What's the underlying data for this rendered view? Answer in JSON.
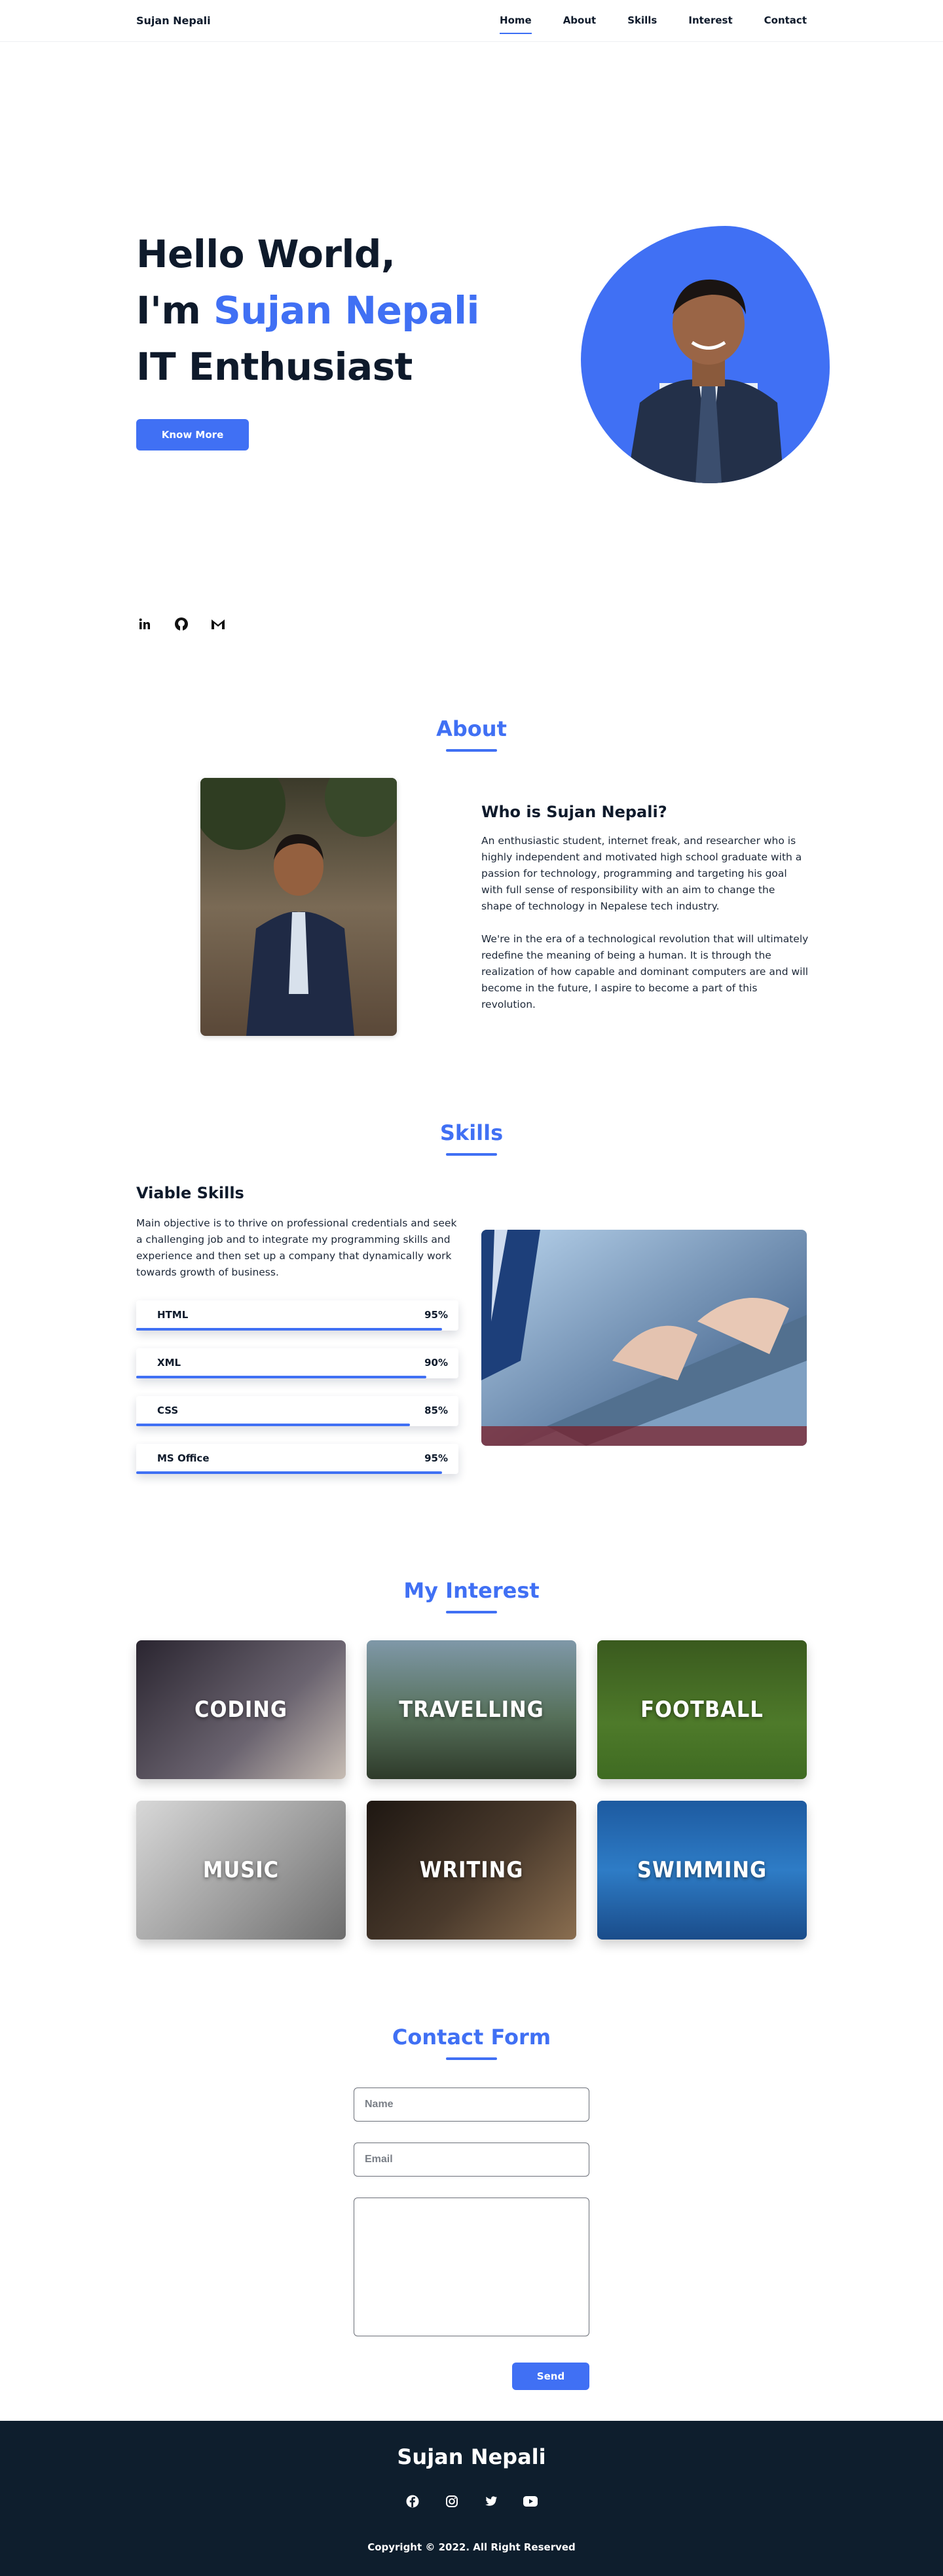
{
  "header": {
    "logo": "Sujan Nepali",
    "nav": [
      "Home",
      "About",
      "Skills",
      "Interest",
      "Contact"
    ]
  },
  "hero": {
    "line1": "Hello World,",
    "line2_prefix": "I'm ",
    "line2_accent": "Sujan Nepali",
    "line3": "IT Enthusiast",
    "button": "Know More",
    "socials": [
      "linkedin-icon",
      "github-icon",
      "gmail-icon"
    ]
  },
  "about": {
    "title": "About",
    "heading": "Who is Sujan Nepali?",
    "para1": "An enthusiastic student, internet freak, and researcher who is highly independent and motivated high school graduate with a passion for technology, programming and targeting his goal with full sense of responsibility with an aim to change the shape of technology in Nepalese tech industry.",
    "para2": "We're in the era of a technological revolution that will ultimately redefine the meaning of being a human. It is through the realization of how capable and dominant computers are and will become in the future, I aspire to become a part of this revolution."
  },
  "skills": {
    "title": "Skills",
    "heading": "Viable Skills",
    "para": "Main objective is to thrive on professional credentials and seek a challenging job and to integrate my programming skills and experience and then set up a company that dynamically work towards growth of business.",
    "items": [
      {
        "name": "HTML",
        "percent": "95%",
        "value": 0.95
      },
      {
        "name": "XML",
        "percent": "90%",
        "value": 0.9
      },
      {
        "name": "CSS",
        "percent": "85%",
        "value": 0.85
      },
      {
        "name": "MS Office",
        "percent": "95%",
        "value": 0.95
      }
    ]
  },
  "interest": {
    "title": "My Interest",
    "cards": [
      "CODING",
      "TRAVELLING",
      "FOOTBALL",
      "MUSIC",
      "WRITING",
      "SWIMMING"
    ]
  },
  "contact": {
    "title": "Contact Form",
    "name_placeholder": "Name",
    "email_placeholder": "Email",
    "message_placeholder": "",
    "button": "Send"
  },
  "footer": {
    "name": "Sujan Nepali",
    "icons": [
      "facebook-icon",
      "instagram-icon",
      "twitter-icon",
      "youtube-icon"
    ],
    "copyright": "Copyright © 2022. All Right Reserved"
  },
  "colors": {
    "accent": "#4070f4",
    "dark": "#0e1e2d"
  }
}
